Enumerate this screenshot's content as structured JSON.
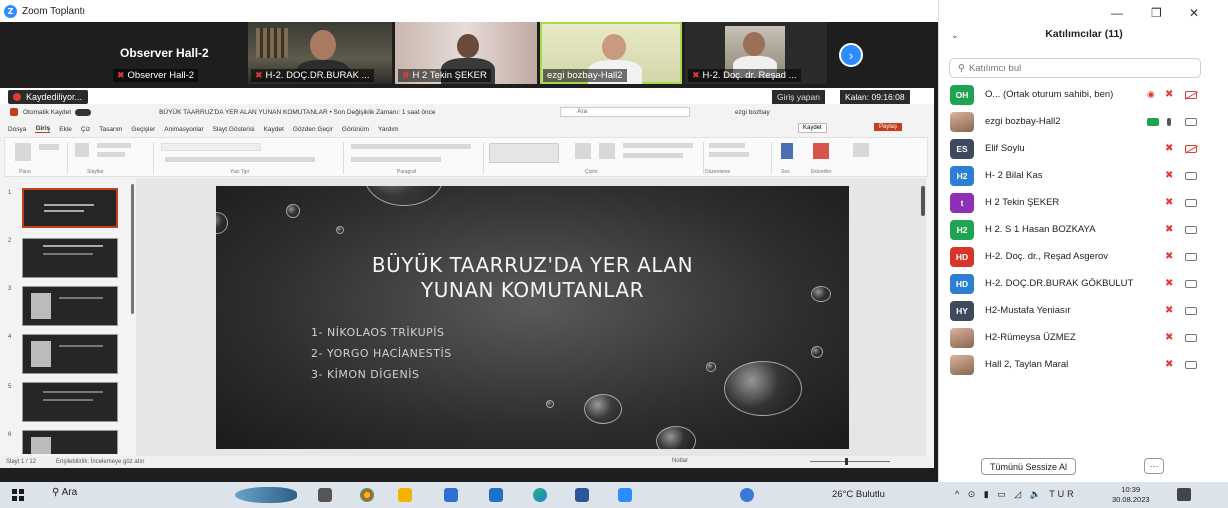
{
  "window": {
    "title": "Zoom Toplantı",
    "controls": [
      "—",
      "❐",
      "✕"
    ]
  },
  "video_strip": {
    "observer_tile": {
      "title": "Observer Hall-2",
      "name": "Observer Hall-2"
    },
    "tiles": [
      {
        "name": "H-2. DOÇ.DR.BURAK ..."
      },
      {
        "name": "H 2 Tekin ŞEKER"
      },
      {
        "name": "ezgi bozbay-Hall2"
      },
      {
        "name": "H-2. Doç. dr. Reşad ..."
      }
    ],
    "recording_label": "Kaydediliyor...",
    "join_label": "Giriş yapan",
    "remaining_label": "Kalan: 09:16:08"
  },
  "ppt": {
    "titlebar_left": "Otomatik Kaydet",
    "doc_title": "BÜYÜK TAARRUZ'DA YER ALAN YUNAN KOMUTANLAR • Son Değişiklik Zamanı: 1 saat önce",
    "search_placeholder": "Ara",
    "user_name": "ezgi bozbay",
    "menu": [
      "Dosya",
      "Giriş",
      "Ekle",
      "Çiz",
      "Tasarım",
      "Geçişler",
      "Animasyonlar",
      "Slayt Gösterisi",
      "Kaydet",
      "Gözden Geçir",
      "Görünüm",
      "Yardım"
    ],
    "kaydet_button": "Kaydet",
    "paylas_button": "Paylaş",
    "ribbon_groups": [
      "Pano",
      "Slaytlar",
      "Yazı Tipi",
      "Paragraf",
      "Çizim",
      "Düzenleme",
      "Ses",
      "Eklentiler"
    ],
    "thumb_numbers": [
      "1",
      "2",
      "3",
      "4",
      "5",
      "6"
    ],
    "status_left": "Slayt 1 / 12",
    "status_accessibility": "Erişilebilirlik: İncelemeye göz atın",
    "status_notes": "Notlar"
  },
  "slide": {
    "title_line1": "BÜYÜK TAARRUZ'DA YER ALAN",
    "title_line2": "YUNAN KOMUTANLAR",
    "items": [
      "1- NİKOLAOS TRİKUPİS",
      "2- YORGO HACİANESTİS",
      "3- KİMON DİGENİS"
    ]
  },
  "participants": {
    "header": "Katılımcılar (11)",
    "search_placeholder": "Katılımcı bul",
    "list": [
      {
        "initials": "OH",
        "color": "#21a354",
        "name": "O... (Ortak oturum sahibi, ben)"
      },
      {
        "initials": "",
        "color": "photo",
        "name": "ezgi bozbay-Hall2"
      },
      {
        "initials": "ES",
        "color": "#3d4a5c",
        "name": "Elif Soylu"
      },
      {
        "initials": "H2",
        "color": "#2d7fd6",
        "name": "H- 2 Bilal Kas"
      },
      {
        "initials": "t",
        "color": "#8e2fb5",
        "name": "H 2 Tekin ŞEKER"
      },
      {
        "initials": "H2",
        "color": "#21a354",
        "name": "H 2. S 1 Hasan BOZKAYA"
      },
      {
        "initials": "HD",
        "color": "#d9342b",
        "name": "H-2. Doç. dr., Reşad Asgerov"
      },
      {
        "initials": "HD",
        "color": "#2d7fd6",
        "name": "H-2. DOÇ.DR.BURAK GÖKBULUT"
      },
      {
        "initials": "HY",
        "color": "#3d4a5c",
        "name": "H2-Mustafa Yeniasır"
      },
      {
        "initials": "",
        "color": "photo",
        "name": "H2-Rümeysa ÜZMEZ"
      },
      {
        "initials": "",
        "color": "photo",
        "name": "Hall 2, Taylan Maral"
      }
    ],
    "mute_all_button": "Tümünü Sessize Al",
    "more_button": "⋯"
  },
  "taskbar": {
    "search_label": "Ara",
    "weather": "26°C  Bulutlu",
    "tray": "^ ⊙ ▮ ▭ ◿ 🔈 TUR",
    "time": "10:39",
    "date": "30.08.2023"
  }
}
